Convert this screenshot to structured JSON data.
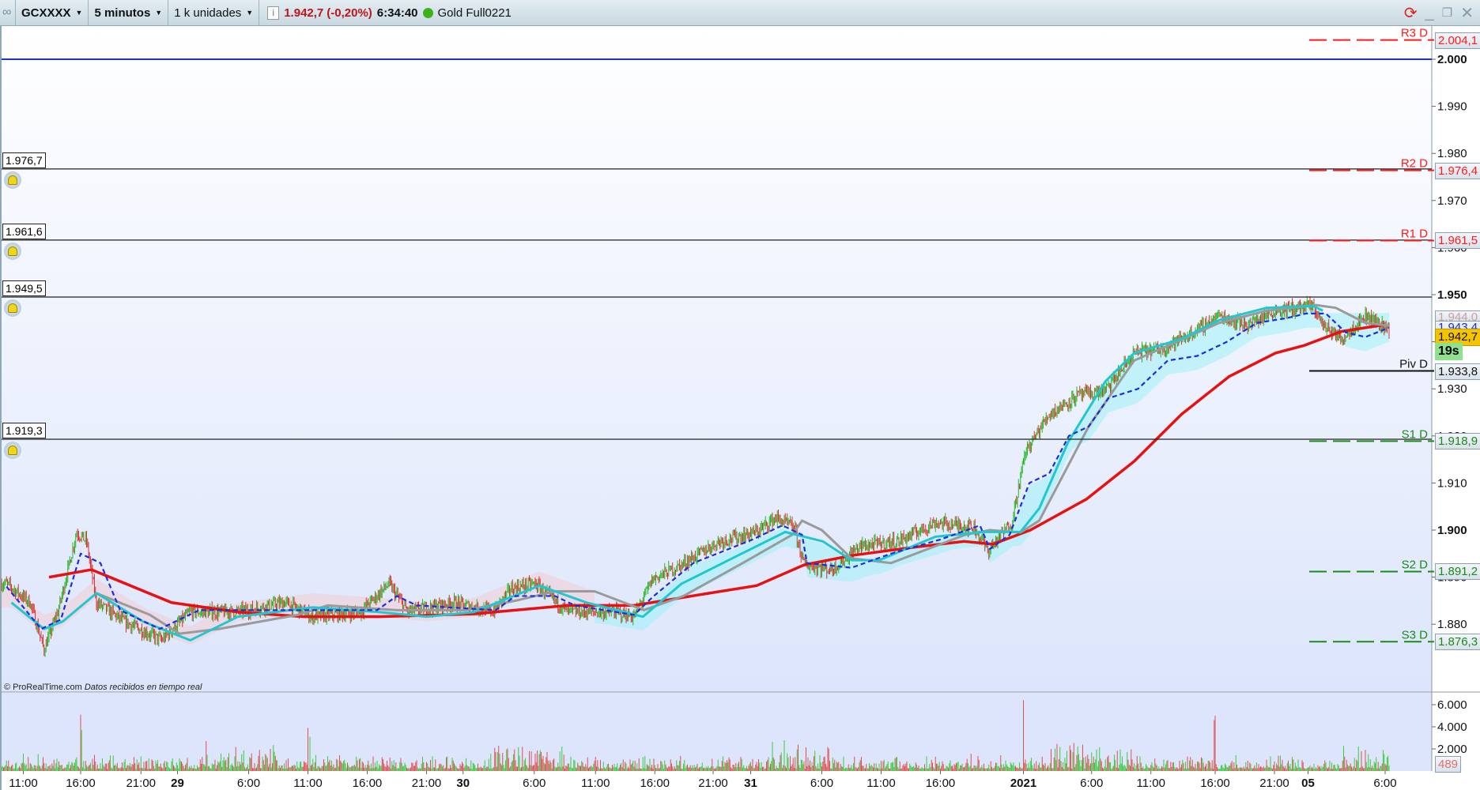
{
  "toolbar": {
    "symbol": "GCXXXX",
    "timeframe": "5 minutos",
    "units": "1 k unidades",
    "info_icon": "info-icon",
    "last_price": "1.942,7",
    "change": "(-0,20%)",
    "time": "6:34:40",
    "status_color": "#3db01b",
    "instrument": "Gold Full0221"
  },
  "window_controls": {
    "refresh": "refresh-icon",
    "minimize": "minimize-icon",
    "restore": "restore-icon",
    "close": "close-icon"
  },
  "footer": {
    "copyright": "© ProRealTime.com",
    "data_note": "Datos recibidos en tiempo real"
  },
  "alerts": [
    {
      "label": "1.976,7",
      "price": 1976.7
    },
    {
      "label": "1.961,6",
      "price": 1961.6
    },
    {
      "label": "1.949,5",
      "price": 1949.5
    },
    {
      "label": "1.919,3",
      "price": 1919.3
    }
  ],
  "pivots": [
    {
      "name": "R3 D",
      "value": "2.004,1",
      "price": 2004.1,
      "color": "#ff1a1a",
      "dash": true
    },
    {
      "name": "R2 D",
      "value": "1.976,4",
      "price": 1976.4,
      "color": "#ff1a1a",
      "dash": true
    },
    {
      "name": "R1 D",
      "value": "1.961,5",
      "price": 1961.5,
      "color": "#ff1a1a",
      "dash": true
    },
    {
      "name": "Piv D",
      "value": "1.933,8",
      "price": 1933.8,
      "color": "#111111",
      "dash": false
    },
    {
      "name": "S1 D",
      "value": "1.918,9",
      "price": 1918.9,
      "color": "#1a8a1a",
      "dash": true
    },
    {
      "name": "S2 D",
      "value": "1.891,2",
      "price": 1891.2,
      "color": "#1a8a1a",
      "dash": true
    },
    {
      "name": "S3 D",
      "value": "1.876,3",
      "price": 1876.3,
      "color": "#1a8a1a",
      "dash": true
    }
  ],
  "price_boxes": {
    "ind1": "1.944,0",
    "ind2": "1.943,4",
    "last": "1.942,7",
    "countdown": "19s",
    "volume_last": "489"
  },
  "chart_data": {
    "type": "line",
    "title": "GCXXXX 5 minutos",
    "ylim": [
      1866,
      2008
    ],
    "y_ticks": [
      {
        "v": 2000,
        "l": "2.000",
        "b": true
      },
      {
        "v": 1990,
        "l": "1.990"
      },
      {
        "v": 1980,
        "l": "1.980"
      },
      {
        "v": 1970,
        "l": "1.970"
      },
      {
        "v": 1960,
        "l": "1.960"
      },
      {
        "v": 1950,
        "l": "1.950",
        "b": true
      },
      {
        "v": 1940,
        "l": "1.940"
      },
      {
        "v": 1930,
        "l": "1.930"
      },
      {
        "v": 1920,
        "l": "1.920"
      },
      {
        "v": 1910,
        "l": "1.910"
      },
      {
        "v": 1900,
        "l": "1.900",
        "b": true
      },
      {
        "v": 1890,
        "l": "1.890"
      },
      {
        "v": 1880,
        "l": "1.880"
      }
    ],
    "horizontal_line": {
      "price": 2000,
      "color": "#1f2fd6"
    },
    "x_ticks": [
      {
        "bar": 22,
        "l": "11:00"
      },
      {
        "bar": 80,
        "l": "16:00"
      },
      {
        "bar": 141,
        "l": "21:00"
      },
      {
        "bar": 178,
        "l": "29",
        "b": true
      },
      {
        "bar": 250,
        "l": "6:00"
      },
      {
        "bar": 310,
        "l": "11:00"
      },
      {
        "bar": 370,
        "l": "16:00"
      },
      {
        "bar": 430,
        "l": "21:00"
      },
      {
        "bar": 467,
        "l": "30",
        "b": true
      },
      {
        "bar": 539,
        "l": "6:00"
      },
      {
        "bar": 601,
        "l": "11:00"
      },
      {
        "bar": 661,
        "l": "16:00"
      },
      {
        "bar": 720,
        "l": "21:00"
      },
      {
        "bar": 758,
        "l": "31",
        "b": true
      },
      {
        "bar": 830,
        "l": "6:00"
      },
      {
        "bar": 890,
        "l": "11:00"
      },
      {
        "bar": 950,
        "l": "16:00"
      },
      {
        "bar": 1034,
        "l": "2021",
        "b": true
      },
      {
        "bar": 1103,
        "l": "6:00"
      },
      {
        "bar": 1163,
        "l": "11:00"
      },
      {
        "bar": 1228,
        "l": "16:00"
      },
      {
        "bar": 1288,
        "l": "21:00"
      },
      {
        "bar": 1322,
        "l": "05",
        "b": true
      },
      {
        "bar": 1400,
        "l": "6:00"
      }
    ],
    "price": [
      [
        5,
        1888.6
      ],
      [
        29,
        1884.6
      ],
      [
        43,
        1874.6
      ],
      [
        57,
        1882.6
      ],
      [
        76,
        1899.6
      ],
      [
        86,
        1897.6
      ],
      [
        96,
        1884.6
      ],
      [
        124,
        1880.6
      ],
      [
        162,
        1876.6
      ],
      [
        191,
        1882.6
      ],
      [
        239,
        1882.6
      ],
      [
        287,
        1884.6
      ],
      [
        315,
        1881.6
      ],
      [
        363,
        1882.6
      ],
      [
        392,
        1888.6
      ],
      [
        411,
        1882.6
      ],
      [
        458,
        1884.6
      ],
      [
        497,
        1882.6
      ],
      [
        516,
        1887.6
      ],
      [
        540,
        1888.6
      ],
      [
        573,
        1882.6
      ],
      [
        621,
        1882.6
      ],
      [
        640,
        1881.6
      ],
      [
        659,
        1889.6
      ],
      [
        688,
        1892.6
      ],
      [
        726,
        1897.6
      ],
      [
        764,
        1899.6
      ],
      [
        783,
        1902.6
      ],
      [
        802,
        1900.6
      ],
      [
        812,
        1892.6
      ],
      [
        840,
        1891.6
      ],
      [
        869,
        1896.6
      ],
      [
        907,
        1897.6
      ],
      [
        945,
        1901.6
      ],
      [
        984,
        1900.6
      ],
      [
        998,
        1895.6
      ],
      [
        1022,
        1901.6
      ],
      [
        1036,
        1916.6
      ],
      [
        1060,
        1924.6
      ],
      [
        1089,
        1928.6
      ],
      [
        1117,
        1929.6
      ],
      [
        1146,
        1937.6
      ],
      [
        1175,
        1938.6
      ],
      [
        1203,
        1941.6
      ],
      [
        1232,
        1945.6
      ],
      [
        1261,
        1943.6
      ],
      [
        1289,
        1946.6
      ],
      [
        1327,
        1947.6
      ],
      [
        1337,
        1943.6
      ],
      [
        1356,
        1940.6
      ],
      [
        1380,
        1945.6
      ],
      [
        1404,
        1942.7
      ]
    ],
    "series": [
      {
        "name": "MA red",
        "color": "#e81010",
        "width": 3.5,
        "dash": false,
        "points": [
          [
            48,
            1890.0
          ],
          [
            91,
            1891.6
          ],
          [
            172,
            1884.6
          ],
          [
            239,
            1882.6
          ],
          [
            306,
            1881.6
          ],
          [
            382,
            1881.6
          ],
          [
            478,
            1882.2
          ],
          [
            573,
            1884.0
          ],
          [
            640,
            1884.0
          ],
          [
            716,
            1886.6
          ],
          [
            764,
            1888.2
          ],
          [
            812,
            1892.6
          ],
          [
            860,
            1894.6
          ],
          [
            917,
            1896.2
          ],
          [
            974,
            1897.6
          ],
          [
            1003,
            1897.0
          ],
          [
            1041,
            1900.0
          ],
          [
            1098,
            1906.6
          ],
          [
            1146,
            1914.6
          ],
          [
            1194,
            1924.6
          ],
          [
            1242,
            1932.6
          ],
          [
            1289,
            1937.6
          ],
          [
            1318,
            1939.2
          ],
          [
            1356,
            1942.2
          ],
          [
            1399,
            1943.6
          ]
        ]
      },
      {
        "name": "MA gray",
        "color": "#9a9a9a",
        "width": 3,
        "dash": false,
        "points": [
          [
            96,
            1886.6
          ],
          [
            150,
            1882.0
          ],
          [
            180,
            1878
          ],
          [
            220,
            1879
          ],
          [
            300,
            1882
          ],
          [
            330,
            1884
          ],
          [
            400,
            1883
          ],
          [
            470,
            1883
          ],
          [
            520,
            1885
          ],
          [
            560,
            1887
          ],
          [
            600,
            1887
          ],
          [
            650,
            1883
          ],
          [
            690,
            1886
          ],
          [
            750,
            1893
          ],
          [
            800,
            1899
          ],
          [
            810,
            1902
          ],
          [
            830,
            1900
          ],
          [
            860,
            1894
          ],
          [
            900,
            1893
          ],
          [
            950,
            1897
          ],
          [
            975,
            1899
          ],
          [
            1000,
            1900
          ],
          [
            1031,
            1899.5
          ],
          [
            1050,
            1902
          ],
          [
            1100,
            1922
          ],
          [
            1146,
            1936
          ],
          [
            1232,
            1944
          ],
          [
            1280,
            1946.6
          ],
          [
            1330,
            1947.8
          ],
          [
            1350,
            1947.2
          ],
          [
            1380,
            1944
          ],
          [
            1404,
            1943.4
          ]
        ]
      },
      {
        "name": "MA cyan",
        "color": "#1fc8d0",
        "width": 3,
        "dash": false,
        "points": [
          [
            10,
            1884.6
          ],
          [
            43,
            1879.0
          ],
          [
            62,
            1880.6
          ],
          [
            96,
            1886.6
          ],
          [
            143,
            1880.6
          ],
          [
            191,
            1876.6
          ],
          [
            239,
            1881.6
          ],
          [
            315,
            1883.6
          ],
          [
            382,
            1882.6
          ],
          [
            430,
            1881.6
          ],
          [
            478,
            1882.6
          ],
          [
            544,
            1888.2
          ],
          [
            592,
            1884.6
          ],
          [
            649,
            1881.6
          ],
          [
            688,
            1888.6
          ],
          [
            745,
            1894.6
          ],
          [
            793,
            1899.6
          ],
          [
            831,
            1897.6
          ],
          [
            860,
            1893.6
          ],
          [
            888,
            1893.6
          ],
          [
            945,
            1898.6
          ],
          [
            993,
            1899.6
          ],
          [
            1031,
            1899.6
          ],
          [
            1050,
            1904.6
          ],
          [
            1079,
            1918.6
          ],
          [
            1117,
            1931.6
          ],
          [
            1146,
            1937.6
          ],
          [
            1194,
            1940.6
          ],
          [
            1232,
            1944.6
          ],
          [
            1280,
            1947.2
          ],
          [
            1327,
            1947.6
          ],
          [
            1337,
            1946.6
          ]
        ]
      },
      {
        "name": "MA blue dashed",
        "color": "#1a2ee0",
        "width": 2.2,
        "dash": true,
        "points": [
          [
            5,
            1888
          ],
          [
            40,
            1879
          ],
          [
            60,
            1881
          ],
          [
            80,
            1895
          ],
          [
            100,
            1893
          ],
          [
            120,
            1883
          ],
          [
            160,
            1879
          ],
          [
            200,
            1883
          ],
          [
            300,
            1883
          ],
          [
            380,
            1883
          ],
          [
            400,
            1886
          ],
          [
            420,
            1884
          ],
          [
            500,
            1883
          ],
          [
            520,
            1886
          ],
          [
            560,
            1886
          ],
          [
            580,
            1884
          ],
          [
            640,
            1882
          ],
          [
            660,
            1886
          ],
          [
            700,
            1893
          ],
          [
            760,
            1898
          ],
          [
            790,
            1901
          ],
          [
            810,
            1899
          ],
          [
            815,
            1893
          ],
          [
            860,
            1892
          ],
          [
            900,
            1895
          ],
          [
            950,
            1898
          ],
          [
            990,
            1901
          ],
          [
            1000,
            1896
          ],
          [
            1020,
            1899
          ],
          [
            1040,
            1910
          ],
          [
            1060,
            1912
          ],
          [
            1080,
            1920
          ],
          [
            1100,
            1922
          ],
          [
            1120,
            1928
          ],
          [
            1150,
            1930
          ],
          [
            1180,
            1936
          ],
          [
            1210,
            1937
          ],
          [
            1240,
            1940
          ],
          [
            1270,
            1944
          ],
          [
            1300,
            1945
          ],
          [
            1320,
            1946
          ],
          [
            1340,
            1946
          ],
          [
            1360,
            1942
          ],
          [
            1380,
            1941
          ],
          [
            1404,
            1943
          ]
        ]
      }
    ],
    "volume": {
      "ticks": [
        {
          "v": 6000,
          "l": "6.000"
        },
        {
          "v": 4000,
          "l": "4.000"
        },
        {
          "v": 2000,
          "l": "2.000"
        }
      ],
      "peaks": [
        [
          80,
          5100
        ],
        [
          81,
          3700
        ],
        [
          310,
          3900
        ],
        [
          312,
          3100
        ],
        [
          1034,
          6400
        ],
        [
          1227,
          4600
        ],
        [
          1228,
          5000
        ],
        [
          1062,
          2000
        ]
      ],
      "last": 489
    }
  }
}
